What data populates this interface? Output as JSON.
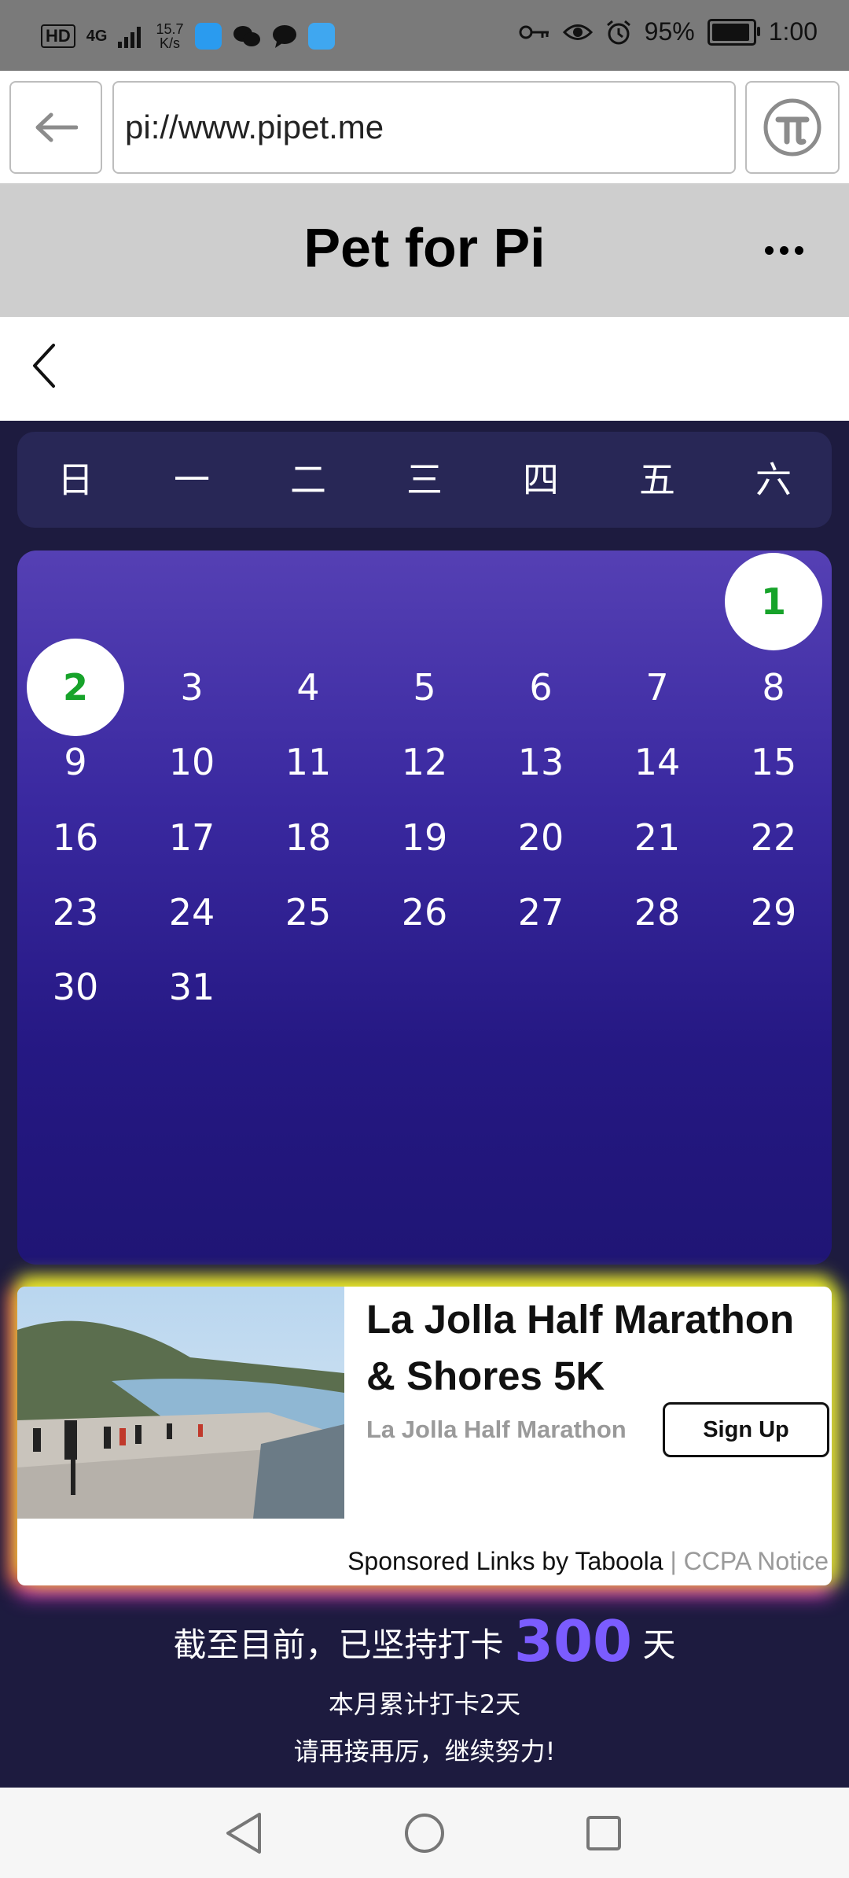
{
  "statusbar": {
    "hd": "HD",
    "signal": "4G",
    "speed_value": "15.7",
    "speed_unit": "K/s",
    "battery": "95%",
    "time": "1:00",
    "battery_level": 0.95
  },
  "browser": {
    "url": "pi://www.pipet.me"
  },
  "app": {
    "title": "Pet for Pi"
  },
  "weekdays": [
    "日",
    "一",
    "二",
    "三",
    "四",
    "五",
    "六"
  ],
  "calendar": {
    "first_weekday_index": 6,
    "days": [
      "1",
      "2",
      "3",
      "4",
      "5",
      "6",
      "7",
      "8",
      "9",
      "10",
      "11",
      "12",
      "13",
      "14",
      "15",
      "16",
      "17",
      "18",
      "19",
      "20",
      "21",
      "22",
      "23",
      "24",
      "25",
      "26",
      "27",
      "28",
      "29",
      "30",
      "31"
    ],
    "checked_days": [
      "1",
      "2"
    ],
    "colors": {
      "checked_text": "#17a32a",
      "gradient_top": "#5540b4",
      "gradient_bottom": "#1f1575"
    }
  },
  "ad": {
    "title": "La Jolla Half Marathon & Shores 5K",
    "source": "La Jolla Half Marathon",
    "button": "Sign Up",
    "sponsored": "Sponsored Links by Taboola",
    "separator": " | ",
    "ccpa": "CCPA Notice"
  },
  "summary": {
    "prefix": "截至目前，已坚持打卡",
    "count": "300",
    "suffix": "天",
    "month_line": "本月累计打卡2天",
    "encourage": "请再接再厉，继续努力!",
    "accent_color": "#7b5cff"
  },
  "icons": {
    "back": "arrow-left-icon",
    "pi": "pi-logo-icon",
    "more": "more-dots-icon",
    "nav_back": "triangle-back-icon",
    "nav_home": "circle-home-icon",
    "nav_recent": "square-recent-icon"
  }
}
